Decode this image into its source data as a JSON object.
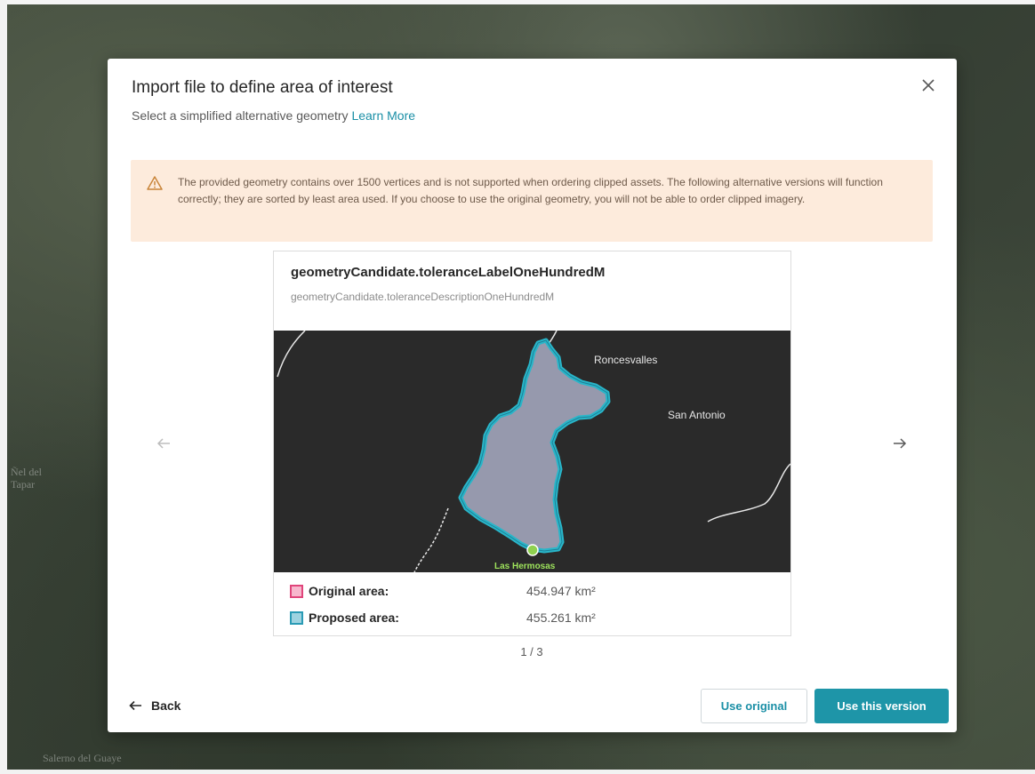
{
  "background": {
    "labels": [
      "Salerno del Guaye",
      "Ñel del",
      "Tapar"
    ]
  },
  "modal": {
    "title": "Import file to define area of interest",
    "subtitle": "Select a simplified alternative geometry",
    "learn_more": "Learn More",
    "close_icon": "close-icon",
    "warning": {
      "icon": "warning-triangle-icon",
      "text": "The provided geometry contains over 1500 vertices and is not supported when ordering clipped assets. The following alternative versions will function correctly; they are sorted by least area used. If you choose to use the original geometry, you will not be able to order clipped imagery."
    },
    "card": {
      "title": "geometryCandidate.toleranceLabelOneHundredM",
      "description": "geometryCandidate.toleranceDescriptionOneHundredM",
      "map": {
        "places": [
          "Roncesvalles",
          "San Antonio",
          "Las Hermosas"
        ]
      },
      "areas": [
        {
          "label": "Original area:",
          "value": "454.947 km²",
          "color": "#e0457b",
          "fill": "#f7b7cd"
        },
        {
          "label": "Proposed area:",
          "value": "455.261 km²",
          "color": "#2a9bb5",
          "fill": "#9ed3e0"
        }
      ]
    },
    "pager": "1 / 3",
    "prev_icon": "arrow-left-icon",
    "next_icon": "arrow-right-icon",
    "footer": {
      "back": "Back",
      "use_original": "Use original",
      "use_this_version": "Use this version"
    },
    "colors": {
      "accent": "#1e95a8",
      "warning_bg": "#fdebdc",
      "polygon_fill": "#9699ad",
      "polygon_outline": "#29b6c9"
    }
  }
}
